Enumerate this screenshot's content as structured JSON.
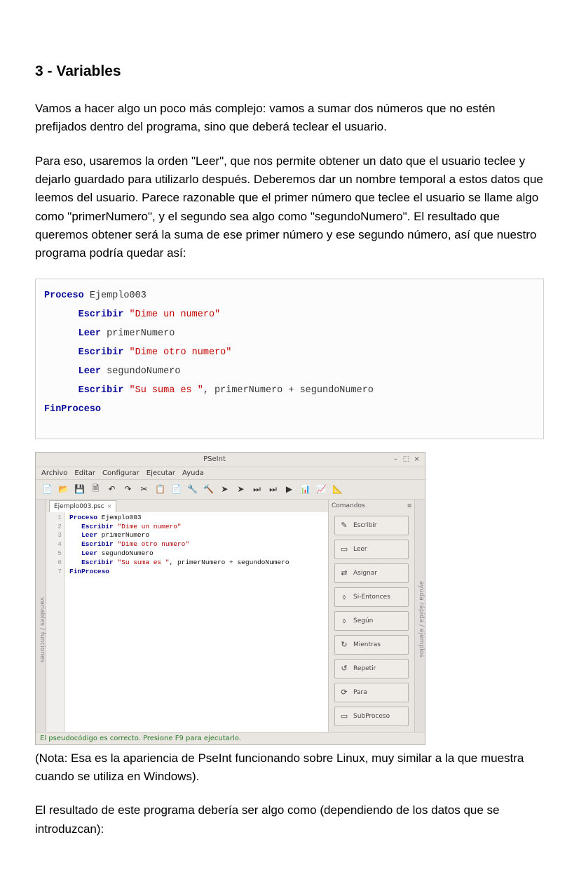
{
  "doc": {
    "heading": "3 - Variables",
    "para1": "Vamos a hacer algo un poco más complejo: vamos a sumar dos números que no estén prefijados dentro del programa, sino que deberá teclear el usuario.",
    "para2": "Para eso, usaremos la orden \"Leer\", que nos permite obtener un dato que el usuario teclee y dejarlo guardado para utilizarlo después. Deberemos dar un nombre temporal a estos datos que leemos del usuario. Parece razonable que el primer número que teclee el usuario se llame algo como \"primerNumero\", y el segundo sea algo como \"segundoNumero\". El resultado que queremos obtener será la suma de ese primer número y ese segundo número, así que nuestro programa podría quedar así:",
    "note": "(Nota: Esa es la apariencia de PseInt funcionando sobre Linux, muy similar a la que muestra cuando se utiliza en Windows).",
    "para3": "El resultado de este programa debería ser algo como (dependiendo de los datos que se introduzcan):"
  },
  "codeSample": {
    "proceso": "Proceso",
    "name": "Ejemplo003",
    "escribir": "Escribir",
    "leer": "Leer",
    "s1": "\"Dime un numero\"",
    "v1": "primerNumero",
    "s2": "\"Dime otro numero\"",
    "v2": "segundoNumero",
    "s3": "\"Su suma es \"",
    "tail": ", primerNumero + segundoNumero",
    "fin": "FinProceso"
  },
  "app": {
    "title": "PSeInt",
    "winMin": "–",
    "winMax": "⬚",
    "winClose": "×",
    "menus": [
      "Archivo",
      "Editar",
      "Configurar",
      "Ejecutar",
      "Ayuda"
    ],
    "toolbarIcons": [
      "new-icon",
      "open-icon",
      "save-icon",
      "saveas-icon",
      "undo-icon",
      "redo-icon",
      "cut-icon",
      "copy-icon",
      "paste-icon",
      "find-icon",
      "fix-icon",
      "arrow-icon",
      "arrow2-icon",
      "step-icon",
      "step2-icon",
      "run-icon",
      "chart-icon",
      "graph-icon",
      "flow-icon"
    ],
    "toolbarGlyphs": [
      "📄",
      "📂",
      "💾",
      "🗎",
      "↶",
      "↷",
      "✂",
      "📋",
      "📄",
      "🔧",
      "🔨",
      "➤",
      "➤",
      "⏭",
      "⏭",
      "▶",
      "📊",
      "📈",
      "📐"
    ],
    "tabName": "Ejemplo003.psc",
    "tabClose": "×",
    "lineNumbers": [
      "1",
      "2",
      "3",
      "4",
      "5",
      "6",
      "7"
    ],
    "editorLines": {
      "l1a": "Proceso",
      "l1b": " Ejemplo003",
      "l2a": "Escribir",
      "l2b": "\"Dime un numero\"",
      "l3a": "Leer",
      "l3b": " primerNumero",
      "l4a": "Escribir",
      "l4b": "\"Dime otro numero\"",
      "l5a": "Leer",
      "l5b": " segundoNumero",
      "l6a": "Escribir",
      "l6b": "\"Su suma es \"",
      "l6c": ", primerNumero + segundoNumero",
      "l7": "FinProceso"
    },
    "sidePanel": {
      "header": "Comandos",
      "expandGlyph": "⧈",
      "buttons": [
        {
          "icon": "✎",
          "label": "Escribir"
        },
        {
          "icon": "▭",
          "label": "Leer"
        },
        {
          "icon": "⇄",
          "label": "Asignar"
        },
        {
          "icon": "⬨",
          "label": "Si-Entonces"
        },
        {
          "icon": "⬨",
          "label": "Según"
        },
        {
          "icon": "↻",
          "label": "Mientras"
        },
        {
          "icon": "↺",
          "label": "Repetir"
        },
        {
          "icon": "⟳",
          "label": "Para"
        },
        {
          "icon": "▭",
          "label": "SubProceso"
        }
      ]
    },
    "leftGutterLabel": "variables / funciones",
    "rightGutterLabel": "ayuda rápida / ejemplos",
    "status": "El pseudocódigo es correcto. Presione F9 para ejecutarlo."
  }
}
